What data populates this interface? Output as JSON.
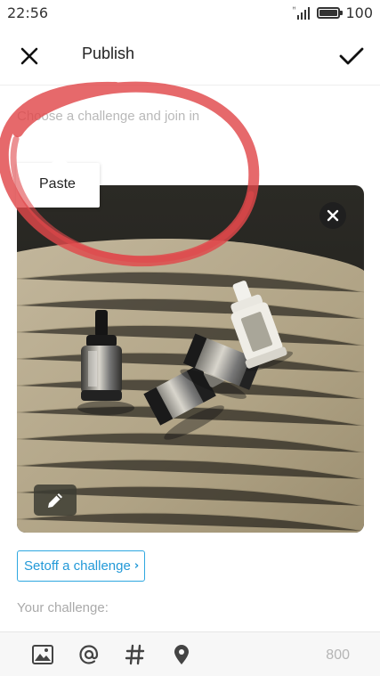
{
  "status_bar": {
    "time": "22:56",
    "battery": "100",
    "icons": [
      "signal-icon",
      "battery-icon"
    ]
  },
  "header": {
    "title": "Publish",
    "icons": [
      "close-icon",
      "check-icon"
    ]
  },
  "challenge": {
    "placeholder": "Choose a challenge and join in"
  },
  "context_menu": {
    "paste_label": "Paste"
  },
  "photo": {
    "icons": [
      "close-icon",
      "pencil-icon"
    ]
  },
  "setoff": {
    "label": "Setoff a challenge",
    "chevron": "›"
  },
  "your_challenge": {
    "label": "Your challenge:"
  },
  "toolbar": {
    "icons": [
      "image-icon",
      "at-icon",
      "hashtag-icon",
      "location-icon"
    ],
    "char_count": "800"
  },
  "colors": {
    "accent": "#2ea7e0",
    "annotation_red": "#e0484b"
  }
}
